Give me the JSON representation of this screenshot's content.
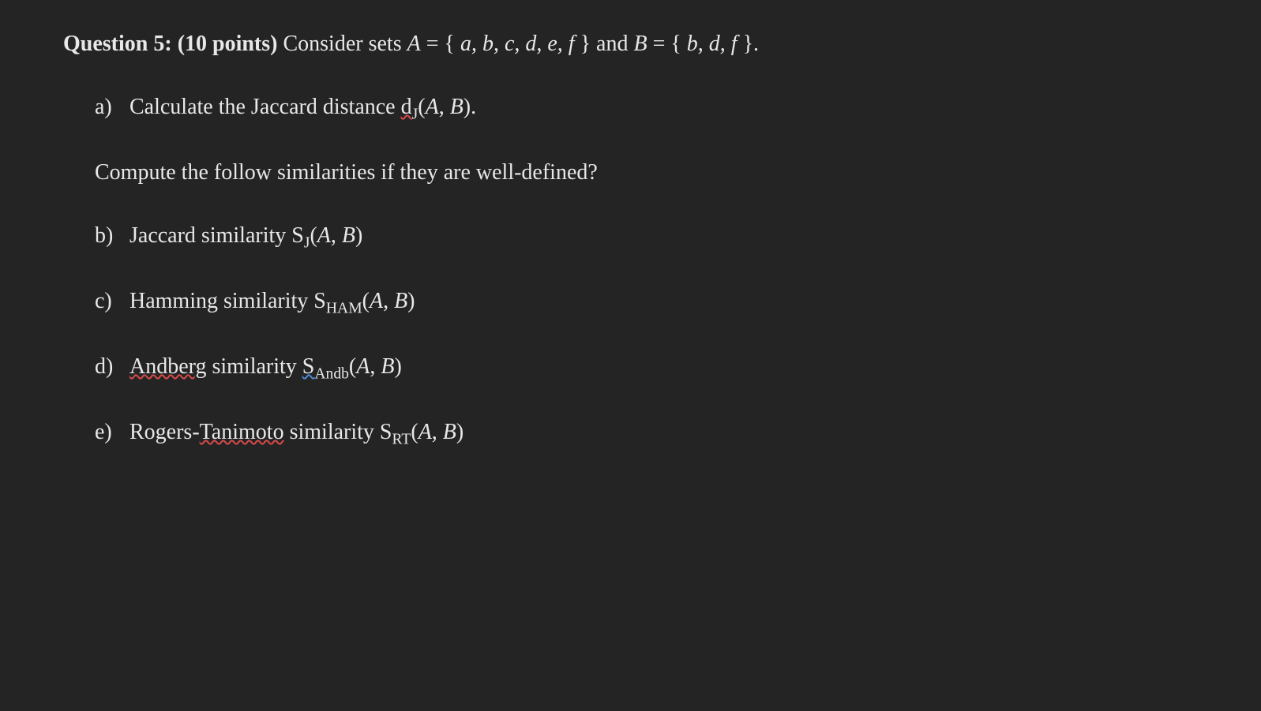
{
  "question": {
    "number": "Question 5:",
    "points": "(10 points)",
    "prompt_prefix": "Consider sets ",
    "setA_name": "A",
    "setA_def": " = {",
    "setA_members": "a, b, c, d, e, f",
    "setA_close": "} and ",
    "setB_name": "B",
    "setB_def": " = {",
    "setB_members": "b, d, f",
    "setB_close": "}."
  },
  "instruction": "Compute the follow similarities if they are well-defined?",
  "items": {
    "a": {
      "label": "a)",
      "prefix": "Calculate the Jaccard distance ",
      "fn": "d",
      "sub": "J",
      "args_open": "(",
      "var1": "A",
      "sep": ", ",
      "var2": "B",
      "args_close": ")."
    },
    "b": {
      "label": "b)",
      "prefix": "Jaccard similarity S",
      "sub": "J",
      "args_open": "(",
      "var1": "A",
      "sep": ", ",
      "var2": "B",
      "args_close": ")"
    },
    "c": {
      "label": "c)",
      "prefix": "Hamming similarity S",
      "sub": "HAM",
      "args_open": "(",
      "var1": "A",
      "sep": ", ",
      "var2": "B",
      "args_close": ")"
    },
    "d": {
      "label": "d)",
      "word1": "Andberg",
      "mid": " similarity ",
      "s_letter": "S",
      "sub": "Andb",
      "args_open": "(",
      "var1": "A",
      "sep": ", ",
      "var2": "B",
      "args_close": ")"
    },
    "e": {
      "label": "e)",
      "prefix1": "Rogers-",
      "word1": "Tanimoto",
      "mid": " similarity S",
      "sub": "RT",
      "args_open": "(",
      "var1": "A",
      "sep": ", ",
      "var2": "B",
      "args_close": ")"
    }
  }
}
